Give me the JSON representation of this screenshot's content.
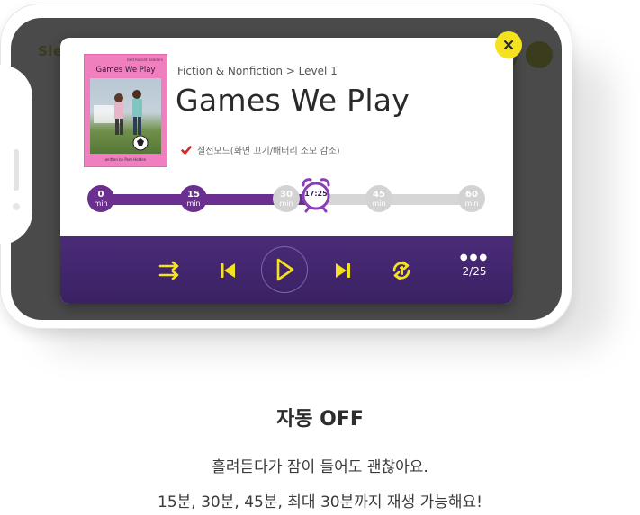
{
  "background_app": {
    "logo_text": "Sleeping English"
  },
  "modal": {
    "cover": {
      "series": "Red Rocket Readers",
      "title": "Games We Play",
      "author": "written by Pam Holden"
    },
    "breadcrumb": "Fiction & Nonfiction > Level 1",
    "title": "Games We Play",
    "power_save": {
      "label": "절전모드(화면 끄기/배터리 소모 감소)",
      "checked": true
    },
    "timer": {
      "current": "17:25",
      "unit": "min",
      "current_fraction": 0.58,
      "marks": [
        {
          "value": "0",
          "active": true
        },
        {
          "value": "15",
          "active": true
        },
        {
          "value": "30",
          "active": false
        },
        {
          "value": "45",
          "active": false
        },
        {
          "value": "60",
          "active": false
        }
      ]
    },
    "controls": {
      "page_indicator": "2/25",
      "accent": "#f4e21e",
      "icons": [
        "shuffle-icon",
        "previous-icon",
        "play-icon",
        "next-icon",
        "repeat-icon",
        "more-icon"
      ]
    }
  },
  "caption": {
    "title": "자동 OFF",
    "line1": "흘려듣다가 잠이 들어도 괜찮아요.",
    "line2": "15분, 30분, 45분, 최대 30분까지 재생 가능해요!"
  },
  "colors": {
    "purple": "#6a2f8f",
    "control_bar": "#3f2468",
    "yellow": "#f4e21e",
    "screen_bg": "#4a4a4a"
  }
}
